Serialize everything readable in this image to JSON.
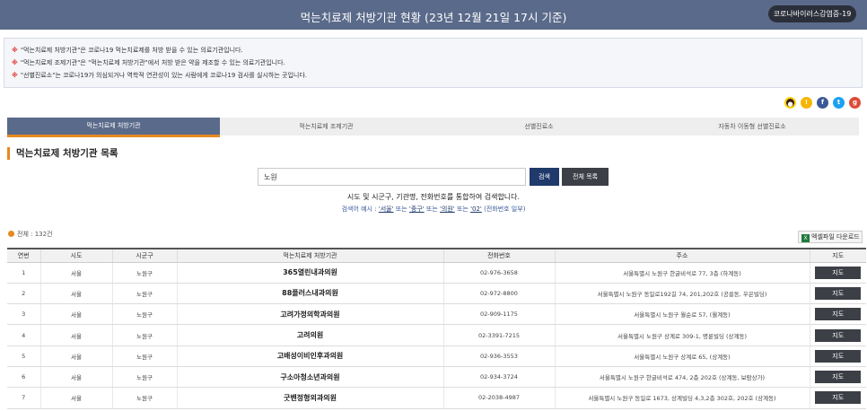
{
  "header": {
    "title": "먹는치료제 처방기관 현황 (23년 12월 21일 17시 기준)",
    "corona_button": "코로나바이러스감염증-19"
  },
  "notice": {
    "mark": "※",
    "lines": [
      "\"먹는치료제 처방기관\"은 코로나19 먹는치료제를 처방 받을 수 있는 의료기관입니다.",
      "\"먹는치료제 조제기관\"은 \"먹는치료제 처방기관\"에서 처방 받은 약을 제조할 수 있는 의료기관입니다.",
      "\"선별진료소\"는 코로나19가 의심되거나 역학적 연관성이 있는 사람에게 코로나19 검사를 실시하는 곳입니다."
    ]
  },
  "share": {
    "icons": [
      "kakaotalk-icon",
      "kakaostory-icon",
      "facebook-icon",
      "twitter-icon",
      "google-plus-icon"
    ]
  },
  "tabs": [
    {
      "label": "먹는치료제 처방기관",
      "active": true
    },
    {
      "label": "먹는치료제 조제기관",
      "active": false
    },
    {
      "label": "선별진료소",
      "active": false
    },
    {
      "label": "자동차 이동형 선별진료소",
      "active": false
    }
  ],
  "section": {
    "title": "먹는치료제 처방기관 목록"
  },
  "search": {
    "value": "노원",
    "search_label": "검색",
    "all_label": "전체 목록",
    "hint": "시도 및 시군구, 기관명, 전화번호를 통합하여 검색합니다.",
    "example_prefix": "검색어 예시 :",
    "example_1": "'서울'",
    "or_1": "또는",
    "example_2": "'중구'",
    "or_2": "또는",
    "example_3": "'의원'",
    "or_3": "또는",
    "example_4": "'02'",
    "example_suffix": "(전화번호 일부)"
  },
  "list": {
    "total": "전체 : 132건",
    "excel_label": "엑셀파일 다운로드",
    "columns": [
      "연번",
      "시도",
      "시군구",
      "먹는치료제 처방기관",
      "전화번호",
      "주소",
      "지도"
    ],
    "map_label": "지도",
    "rows": [
      {
        "no": "1",
        "sido": "서울",
        "sigungu": "노원구",
        "name": "365열린내과의원",
        "phone": "02-976-3658",
        "address": "서울특별시 노원구 한글비석로 77, 3층 (하계동)"
      },
      {
        "no": "2",
        "sido": "서울",
        "sigungu": "노원구",
        "name": "88플러스내과의원",
        "phone": "02-972-8800",
        "address": "서울특별시 노원구 동일로192길 74, 201,202호 (공릉동, 우은빌딩)"
      },
      {
        "no": "3",
        "sido": "서울",
        "sigungu": "노원구",
        "name": "고려가정의학과의원",
        "phone": "02-909-1175",
        "address": "서울특별시 노원구 월순로 57, (월계동)"
      },
      {
        "no": "4",
        "sido": "서울",
        "sigungu": "노원구",
        "name": "고려의원",
        "phone": "02-3391-7215",
        "address": "서울특별시 노원구 상계로 309-1, 명륜빌딩 (상계동)"
      },
      {
        "no": "5",
        "sido": "서울",
        "sigungu": "노원구",
        "name": "고배성이비인후과의원",
        "phone": "02-936-3553",
        "address": "서울특별시 노원구 상계로 65, (상계동)"
      },
      {
        "no": "6",
        "sido": "서울",
        "sigungu": "노원구",
        "name": "구소아청소년과의원",
        "phone": "02-934-3724",
        "address": "서울특별시 노원구 한글비석로 474, 2층 202호 (상계동, 보람상가)"
      },
      {
        "no": "7",
        "sido": "서울",
        "sigungu": "노원구",
        "name": "굿밴정형외과의원",
        "phone": "02-2038-4987",
        "address": "서울특별시 노원구 동일로 1673, 상계빌딩 4,3,2층 302호, 202호 (상계동)"
      }
    ]
  },
  "colors": {
    "header_bg": "#5a6a8a",
    "accent_orange": "#e6891f",
    "search_blue": "#1f3a6b",
    "dark_button": "#3c3f46"
  }
}
